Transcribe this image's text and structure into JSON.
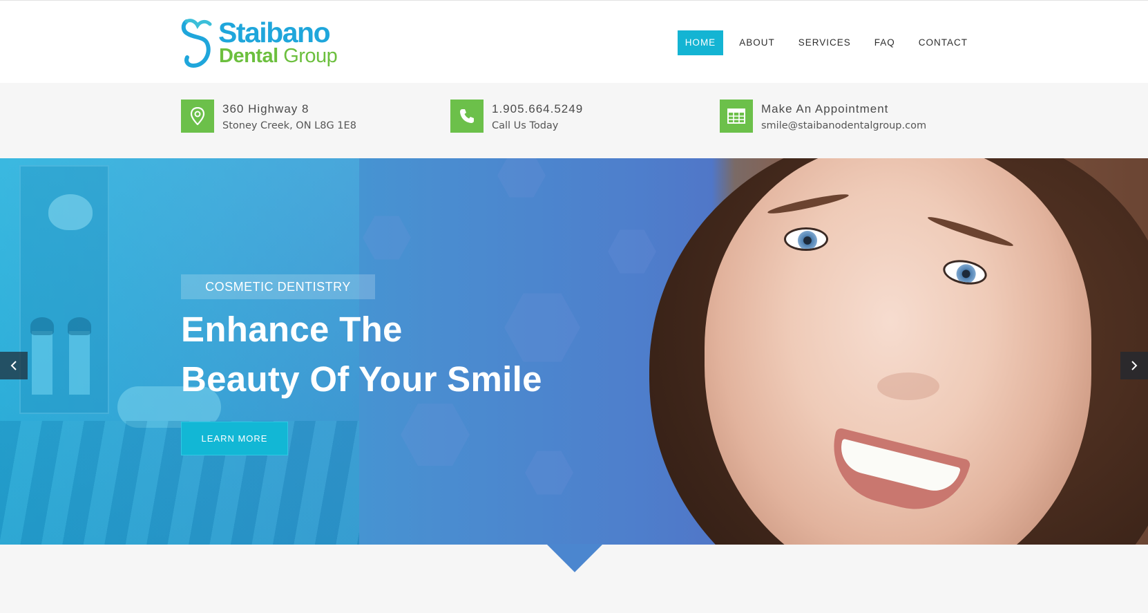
{
  "logo": {
    "line1": "Staibano",
    "line2_part1": "Dental",
    "line2_part2": "Group"
  },
  "nav": {
    "items": [
      {
        "label": "HOME",
        "active": true
      },
      {
        "label": "ABOUT",
        "active": false
      },
      {
        "label": "SERVICES",
        "active": false
      },
      {
        "label": "FAQ",
        "active": false
      },
      {
        "label": "CONTACT",
        "active": false
      }
    ]
  },
  "info": {
    "address": {
      "icon": "map-pin-icon",
      "title": "360 Highway 8",
      "sub": "Stoney Creek, ON L8G 1E8"
    },
    "phone": {
      "icon": "phone-icon",
      "title": "1.905.664.5249",
      "sub": "Call Us Today"
    },
    "appointment": {
      "icon": "calendar-icon",
      "title": "Make An Appointment",
      "sub": "smile@staibanodentalgroup.com"
    }
  },
  "hero": {
    "tag": "COSMETIC DENTISTRY",
    "title_line1": "Enhance The",
    "title_line2": "Beauty Of Your Smile",
    "button_label": "LEARN MORE",
    "prev_icon": "chevron-left-icon",
    "next_icon": "chevron-right-icon"
  },
  "colors": {
    "accent": "#14b4d3",
    "green": "#6cc04a",
    "logo_blue": "#1fa6db",
    "logo_green": "#6cbf3e"
  }
}
